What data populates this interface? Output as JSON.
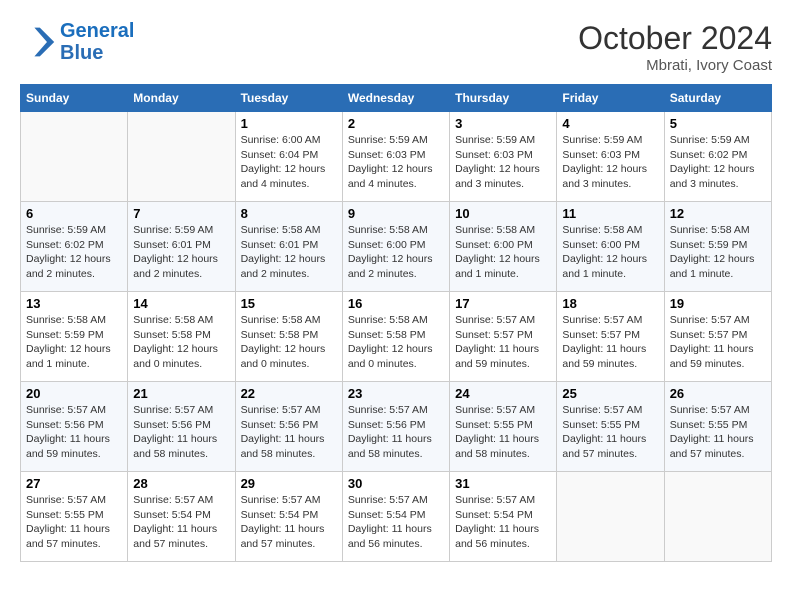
{
  "header": {
    "logo_line1": "General",
    "logo_line2": "Blue",
    "month": "October 2024",
    "location": "Mbrati, Ivory Coast"
  },
  "weekdays": [
    "Sunday",
    "Monday",
    "Tuesday",
    "Wednesday",
    "Thursday",
    "Friday",
    "Saturday"
  ],
  "weeks": [
    [
      {
        "day": "",
        "info": ""
      },
      {
        "day": "",
        "info": ""
      },
      {
        "day": "1",
        "info": "Sunrise: 6:00 AM\nSunset: 6:04 PM\nDaylight: 12 hours and 4 minutes."
      },
      {
        "day": "2",
        "info": "Sunrise: 5:59 AM\nSunset: 6:03 PM\nDaylight: 12 hours and 4 minutes."
      },
      {
        "day": "3",
        "info": "Sunrise: 5:59 AM\nSunset: 6:03 PM\nDaylight: 12 hours and 3 minutes."
      },
      {
        "day": "4",
        "info": "Sunrise: 5:59 AM\nSunset: 6:03 PM\nDaylight: 12 hours and 3 minutes."
      },
      {
        "day": "5",
        "info": "Sunrise: 5:59 AM\nSunset: 6:02 PM\nDaylight: 12 hours and 3 minutes."
      }
    ],
    [
      {
        "day": "6",
        "info": "Sunrise: 5:59 AM\nSunset: 6:02 PM\nDaylight: 12 hours and 2 minutes."
      },
      {
        "day": "7",
        "info": "Sunrise: 5:59 AM\nSunset: 6:01 PM\nDaylight: 12 hours and 2 minutes."
      },
      {
        "day": "8",
        "info": "Sunrise: 5:58 AM\nSunset: 6:01 PM\nDaylight: 12 hours and 2 minutes."
      },
      {
        "day": "9",
        "info": "Sunrise: 5:58 AM\nSunset: 6:00 PM\nDaylight: 12 hours and 2 minutes."
      },
      {
        "day": "10",
        "info": "Sunrise: 5:58 AM\nSunset: 6:00 PM\nDaylight: 12 hours and 1 minute."
      },
      {
        "day": "11",
        "info": "Sunrise: 5:58 AM\nSunset: 6:00 PM\nDaylight: 12 hours and 1 minute."
      },
      {
        "day": "12",
        "info": "Sunrise: 5:58 AM\nSunset: 5:59 PM\nDaylight: 12 hours and 1 minute."
      }
    ],
    [
      {
        "day": "13",
        "info": "Sunrise: 5:58 AM\nSunset: 5:59 PM\nDaylight: 12 hours and 1 minute."
      },
      {
        "day": "14",
        "info": "Sunrise: 5:58 AM\nSunset: 5:58 PM\nDaylight: 12 hours and 0 minutes."
      },
      {
        "day": "15",
        "info": "Sunrise: 5:58 AM\nSunset: 5:58 PM\nDaylight: 12 hours and 0 minutes."
      },
      {
        "day": "16",
        "info": "Sunrise: 5:58 AM\nSunset: 5:58 PM\nDaylight: 12 hours and 0 minutes."
      },
      {
        "day": "17",
        "info": "Sunrise: 5:57 AM\nSunset: 5:57 PM\nDaylight: 11 hours and 59 minutes."
      },
      {
        "day": "18",
        "info": "Sunrise: 5:57 AM\nSunset: 5:57 PM\nDaylight: 11 hours and 59 minutes."
      },
      {
        "day": "19",
        "info": "Sunrise: 5:57 AM\nSunset: 5:57 PM\nDaylight: 11 hours and 59 minutes."
      }
    ],
    [
      {
        "day": "20",
        "info": "Sunrise: 5:57 AM\nSunset: 5:56 PM\nDaylight: 11 hours and 59 minutes."
      },
      {
        "day": "21",
        "info": "Sunrise: 5:57 AM\nSunset: 5:56 PM\nDaylight: 11 hours and 58 minutes."
      },
      {
        "day": "22",
        "info": "Sunrise: 5:57 AM\nSunset: 5:56 PM\nDaylight: 11 hours and 58 minutes."
      },
      {
        "day": "23",
        "info": "Sunrise: 5:57 AM\nSunset: 5:56 PM\nDaylight: 11 hours and 58 minutes."
      },
      {
        "day": "24",
        "info": "Sunrise: 5:57 AM\nSunset: 5:55 PM\nDaylight: 11 hours and 58 minutes."
      },
      {
        "day": "25",
        "info": "Sunrise: 5:57 AM\nSunset: 5:55 PM\nDaylight: 11 hours and 57 minutes."
      },
      {
        "day": "26",
        "info": "Sunrise: 5:57 AM\nSunset: 5:55 PM\nDaylight: 11 hours and 57 minutes."
      }
    ],
    [
      {
        "day": "27",
        "info": "Sunrise: 5:57 AM\nSunset: 5:55 PM\nDaylight: 11 hours and 57 minutes."
      },
      {
        "day": "28",
        "info": "Sunrise: 5:57 AM\nSunset: 5:54 PM\nDaylight: 11 hours and 57 minutes."
      },
      {
        "day": "29",
        "info": "Sunrise: 5:57 AM\nSunset: 5:54 PM\nDaylight: 11 hours and 57 minutes."
      },
      {
        "day": "30",
        "info": "Sunrise: 5:57 AM\nSunset: 5:54 PM\nDaylight: 11 hours and 56 minutes."
      },
      {
        "day": "31",
        "info": "Sunrise: 5:57 AM\nSunset: 5:54 PM\nDaylight: 11 hours and 56 minutes."
      },
      {
        "day": "",
        "info": ""
      },
      {
        "day": "",
        "info": ""
      }
    ]
  ]
}
